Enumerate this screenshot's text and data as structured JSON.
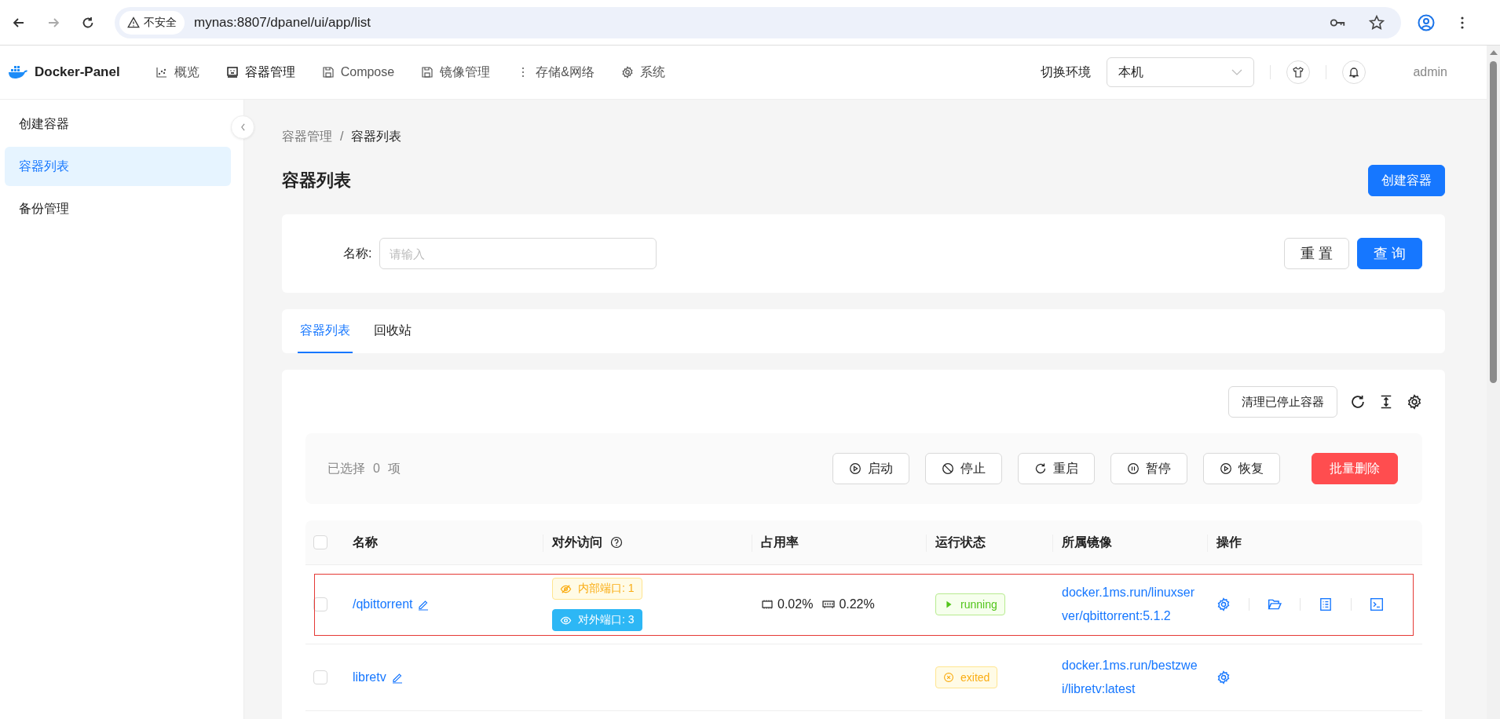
{
  "browser": {
    "security_label": "不安全",
    "url": "mynas:8807/dpanel/ui/app/list"
  },
  "header": {
    "brand": "Docker-Panel",
    "nav": [
      {
        "label": "概览",
        "kind": "chart",
        "selected": false
      },
      {
        "label": "容器管理",
        "kind": "container",
        "selected": true
      },
      {
        "label": "Compose",
        "kind": "compose",
        "selected": false
      },
      {
        "label": "镜像管理",
        "kind": "image",
        "selected": false
      },
      {
        "label": "存储&网络",
        "kind": "storage",
        "selected": false
      },
      {
        "label": "系统",
        "kind": "system",
        "selected": false
      }
    ],
    "env_label": "切换环境",
    "env_value": "本机",
    "user": "admin"
  },
  "sidebar": {
    "items": [
      {
        "label": "创建容器",
        "selected": false
      },
      {
        "label": "容器列表",
        "selected": true
      },
      {
        "label": "备份管理",
        "selected": false
      }
    ]
  },
  "breadcrumb": [
    "容器管理",
    "容器列表"
  ],
  "breadcrumb_separator": "/",
  "page_title": "容器列表",
  "create_button": "创建容器",
  "search": {
    "label": "名称:",
    "placeholder": "请输入",
    "reset_button": "重 置",
    "query_button": "查 询"
  },
  "tabs": [
    {
      "label": "容器列表",
      "selected": true
    },
    {
      "label": "回收站",
      "selected": false
    }
  ],
  "toolbar": {
    "clean_button": "清理已停止容器"
  },
  "selection": {
    "prefix": "已选择",
    "count": "0",
    "suffix": "项",
    "actions": [
      {
        "label": "启动",
        "kind": "start"
      },
      {
        "label": "停止",
        "kind": "stop"
      },
      {
        "label": "重启",
        "kind": "restart"
      },
      {
        "label": "暂停",
        "kind": "pause"
      },
      {
        "label": "恢复",
        "kind": "resume"
      }
    ],
    "delete_button": "批量删除"
  },
  "table": {
    "select_all_checked": false,
    "columns": [
      {
        "label": "名称",
        "kind": "plain"
      },
      {
        "label": "对外访问",
        "kind": "with_help"
      },
      {
        "label": "占用率",
        "kind": "plain"
      },
      {
        "label": "运行状态",
        "kind": "plain"
      },
      {
        "label": "所属镜像",
        "kind": "plain"
      },
      {
        "label": "操作",
        "kind": "plain"
      }
    ],
    "rows": [
      {
        "checked": false,
        "highlighted": true,
        "name": "/qbittorrent",
        "ports": [
          {
            "label": "内部端口: 1",
            "kind": "internal"
          },
          {
            "label": "对外端口: 3",
            "kind": "external"
          }
        ],
        "cpu": "0.02%",
        "memory": "0.22%",
        "status": {
          "label": "running",
          "kind": "running"
        },
        "image": "docker.1ms.run/linuxserver/qbittorrent:5.1.2",
        "actions": [
          {
            "kind": "settings"
          },
          {
            "kind": "folder"
          },
          {
            "kind": "logs"
          },
          {
            "kind": "terminal"
          }
        ]
      },
      {
        "checked": false,
        "highlighted": false,
        "name": "libretv",
        "status": {
          "label": "exited",
          "kind": "exited"
        },
        "image": "docker.1ms.run/bestzwei/libretv:latest",
        "actions": [
          {
            "kind": "settings"
          }
        ]
      }
    ]
  }
}
